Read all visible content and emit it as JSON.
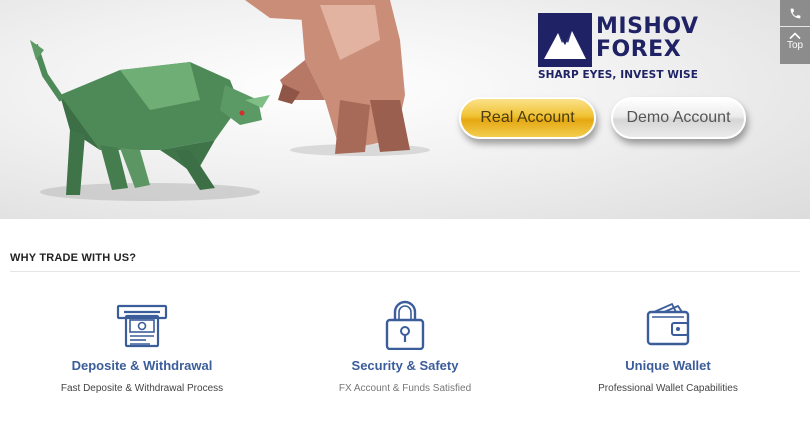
{
  "brand": {
    "name_line1": "MISHOV",
    "name_line2": "FOREX",
    "tagline": "SHARP EYES, INVEST WISE"
  },
  "hero": {
    "real_account_label": "Real Account",
    "demo_account_label": "Demo Account"
  },
  "side": {
    "top_label": "Top"
  },
  "section": {
    "title": "WHY TRADE WITH US?"
  },
  "features": [
    {
      "title": "Deposite & Withdrawal",
      "desc": "Fast Deposite & Withdrawal Process",
      "icon": "atm-cash-icon"
    },
    {
      "title": "Security & Safety",
      "desc": "FX Account & Funds Satisfied",
      "icon": "padlock-icon"
    },
    {
      "title": "Unique Wallet",
      "desc": "Professional Wallet Capabilities",
      "icon": "wallet-icon"
    }
  ],
  "colors": {
    "brand_navy": "#1f2366",
    "feature_title_blue": "#3b5d9a",
    "real_button_gold": "#f0c233",
    "side_tab_gray": "#8c8c8c"
  }
}
